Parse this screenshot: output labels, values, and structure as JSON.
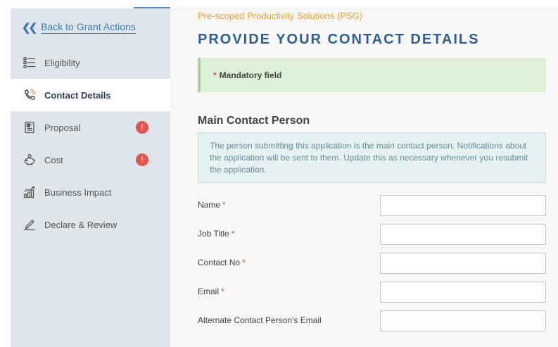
{
  "sidebar": {
    "back_label": "Back to Grant Actions",
    "items": [
      {
        "label": "Eligibility",
        "icon": "checklist-icon",
        "active": false,
        "badge": ""
      },
      {
        "label": "Contact Details",
        "icon": "phone-icon",
        "active": true,
        "badge": ""
      },
      {
        "label": "Proposal",
        "icon": "document-icon",
        "active": false,
        "badge": "!"
      },
      {
        "label": "Cost",
        "icon": "piggy-bank-icon",
        "active": false,
        "badge": "!"
      },
      {
        "label": "Business Impact",
        "icon": "growth-chart-icon",
        "active": false,
        "badge": ""
      },
      {
        "label": "Declare & Review",
        "icon": "pen-signature-icon",
        "active": false,
        "badge": ""
      }
    ]
  },
  "header": {
    "scheme": "Pre-scoped Productivity Solutions (PSG)",
    "title": "PROVIDE YOUR CONTACT DETAILS"
  },
  "notice": {
    "star": "*",
    "text": "Mandatory field"
  },
  "section": {
    "title": "Main Contact Person",
    "info": "The person submitting this application is the main contact person. Notifications about the application will be sent to them. Update this as necessary whenever you resubmit the application."
  },
  "form": {
    "fields": [
      {
        "label": "Name",
        "required": "*",
        "value": ""
      },
      {
        "label": "Job Title",
        "required": "*",
        "value": ""
      },
      {
        "label": "Contact No",
        "required": "*",
        "value": ""
      },
      {
        "label": "Email",
        "required": "*",
        "value": ""
      },
      {
        "label": "Alternate Contact Person's Email",
        "required": "",
        "value": ""
      }
    ]
  },
  "colors": {
    "accent": "#2f5f96",
    "link": "#3a7ab8",
    "scheme": "#e8a23a",
    "badge": "#e0584d",
    "success_bg": "#dff0d8"
  }
}
